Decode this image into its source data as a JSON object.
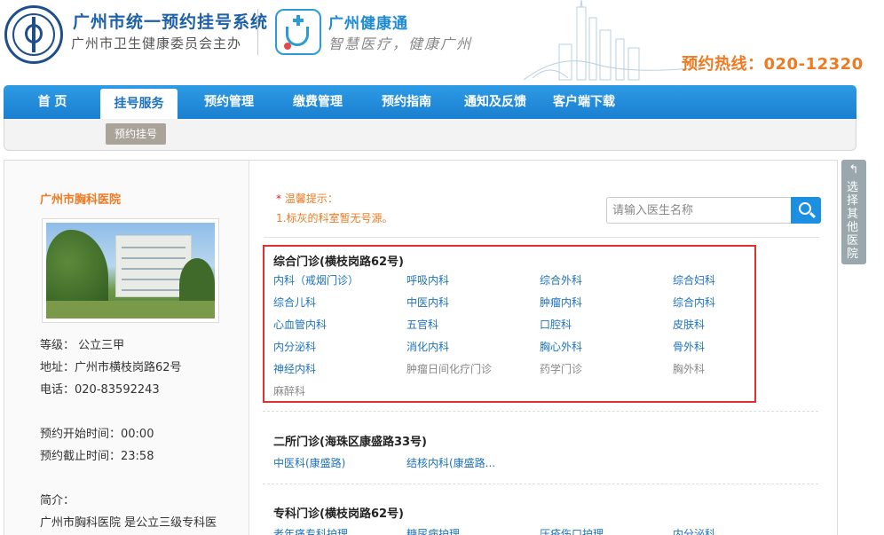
{
  "header": {
    "system_title": "广州市统一预约挂号系统",
    "system_subtitle": "广州市卫生健康委员会主办",
    "app_name": "广州健康通",
    "app_slogan": "智慧医疗，健康广州",
    "hotline": "预约热线：020-12320",
    "colors": {
      "brand_blue": "#1d60a8",
      "accent_orange": "#ee7a22"
    }
  },
  "nav": {
    "items": [
      {
        "label": "首 页"
      },
      {
        "label": "挂号服务"
      },
      {
        "label": "预约管理"
      },
      {
        "label": "缴费管理"
      },
      {
        "label": "预约指南"
      },
      {
        "label": "通知及反馈"
      },
      {
        "label": "客户端下载"
      }
    ],
    "active_index": 1,
    "sub_button": "预约挂号"
  },
  "hospital": {
    "name": "广州市胸科医院",
    "level": "等级： 公立三甲",
    "address": "地址：广州市横枝岗路62号",
    "phone": "电话：020-83592243",
    "start_time": "预约开始时间：00:00",
    "end_time": "预约截止时间：23:58",
    "intro_label": "简介：",
    "intro_text": "广州市胸科医院 是公立三级专科医"
  },
  "tips": {
    "title": "温馨提示：",
    "line1": "1.标灰的科室暂无号源。"
  },
  "search": {
    "placeholder": "请输入医生名称"
  },
  "sections": [
    {
      "title": "综合门诊(横枝岗路62号)",
      "departments": [
        {
          "name": "内科（戒烟门诊）",
          "available": true
        },
        {
          "name": "呼吸内科",
          "available": true
        },
        {
          "name": "综合外科",
          "available": true
        },
        {
          "name": "综合妇科",
          "available": true
        },
        {
          "name": "综合儿科",
          "available": true
        },
        {
          "name": "中医内科",
          "available": true
        },
        {
          "name": "肿瘤内科",
          "available": true
        },
        {
          "name": "综合内科",
          "available": true
        },
        {
          "name": "心血管内科",
          "available": true
        },
        {
          "name": "五官科",
          "available": true
        },
        {
          "name": "口腔科",
          "available": true
        },
        {
          "name": "皮肤科",
          "available": true
        },
        {
          "name": "内分泌科",
          "available": true
        },
        {
          "name": "消化内科",
          "available": true
        },
        {
          "name": "胸心外科",
          "available": true
        },
        {
          "name": "骨外科",
          "available": true
        },
        {
          "name": "神经内科",
          "available": true
        },
        {
          "name": "肿瘤日间化疗门诊",
          "available": false
        },
        {
          "name": "药学门诊",
          "available": false
        },
        {
          "name": "胸外科",
          "available": false
        },
        {
          "name": "麻醉科",
          "available": false
        }
      ]
    },
    {
      "title": "二所门诊(海珠区康盛路33号)",
      "departments": [
        {
          "name": "中医科(康盛路)",
          "available": true
        },
        {
          "name": "结核内科(康盛路...",
          "available": true
        }
      ]
    },
    {
      "title": "专科门诊(横枝岗路62号)",
      "departments": [
        {
          "name": "老年痛专科护理",
          "available": true
        },
        {
          "name": "糖尿病护理",
          "available": true
        },
        {
          "name": "压疮伤口护理",
          "available": true
        },
        {
          "name": "内分泌科",
          "available": true
        }
      ]
    }
  ],
  "side_tab": {
    "label": "选择其他医院"
  }
}
